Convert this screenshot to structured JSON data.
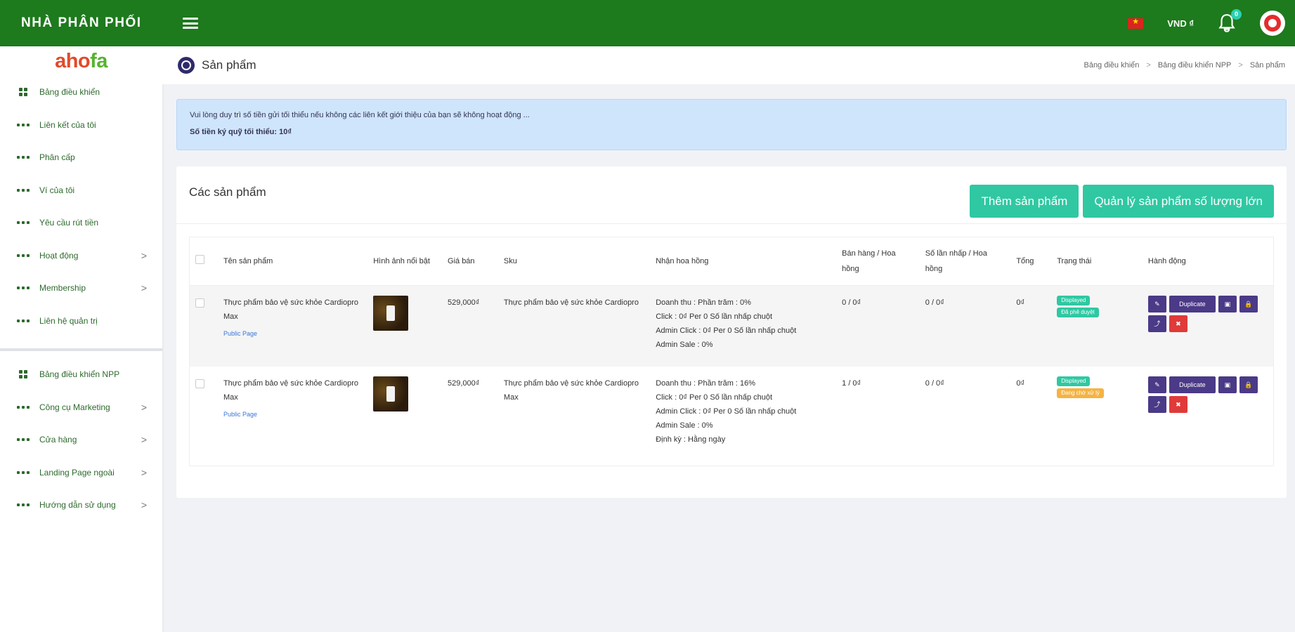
{
  "topbar": {
    "brand": "NHÀ PHÂN PHỐI",
    "currency": "VND ₫",
    "notification_count": "0"
  },
  "sidebar": {
    "logo": {
      "part1": "aho",
      "part2": "fa"
    },
    "items": [
      {
        "label": "Bảng điều khiển",
        "icon": "grid-icon",
        "chevron": ""
      },
      {
        "label": "Liên kết của tôi",
        "icon": "dots-icon",
        "chevron": ""
      },
      {
        "label": "Phân cấp",
        "icon": "dots-icon",
        "chevron": ""
      },
      {
        "label": "Ví của tôi",
        "icon": "dots-icon",
        "chevron": ""
      },
      {
        "label": "Yêu cầu rút tiền",
        "icon": "dots-icon",
        "chevron": ""
      },
      {
        "label": "Hoạt động",
        "icon": "dots-icon",
        "chevron": ">"
      },
      {
        "label": "Membership",
        "icon": "dots-icon",
        "chevron": ">"
      },
      {
        "label": "Liên hệ quản trị",
        "icon": "dots-icon",
        "chevron": ""
      }
    ],
    "items2": [
      {
        "label": "Bảng điều khiển NPP",
        "icon": "grid-icon",
        "chevron": ""
      },
      {
        "label": "Công cụ Marketing",
        "icon": "dots-icon",
        "chevron": ">"
      },
      {
        "label": "Cửa hàng",
        "icon": "dots-icon",
        "chevron": ">"
      },
      {
        "label": "Landing Page ngoài",
        "icon": "dots-icon",
        "chevron": ">"
      },
      {
        "label": "Hướng dẫn sử dụng",
        "icon": "dots-icon",
        "chevron": ">"
      }
    ]
  },
  "page": {
    "title": "Sản phẩm",
    "breadcrumb": [
      "Bảng điều khiển",
      "Bảng điều khiển NPP",
      "Sản phẩm"
    ]
  },
  "notice": {
    "line1": "Vui lòng duy trì số tiền gửi tối thiểu nếu không các liên kết giới thiệu của bạn sẽ không hoạt động ...",
    "line2": "Số tiền ký quỹ tối thiểu: 10₫"
  },
  "products": {
    "title": "Các sản phẩm",
    "add_button": "Thêm sản phẩm",
    "bulk_button": "Quản lý sản phẩm số lượng lớn",
    "columns": [
      "Tên sản phẩm",
      "Hình ảnh nổi bật",
      "Giá bán",
      "Sku",
      "Nhận hoa hồng",
      "Bán hàng / Hoa hồng",
      "Số lần nhấp / Hoa hồng",
      "Tổng",
      "Trạng thái",
      "Hành động"
    ],
    "rows": [
      {
        "name": "Thực phẩm bảo vệ sức khỏe Cardiopro Max",
        "link": "Public Page",
        "price": "529,000₫",
        "sku": "Thực phẩm bảo vệ sức khỏe Cardiopro",
        "commission": [
          "Doanh thu : Phần trăm : 0%",
          "Click : 0₫ Per 0 Số lần nhấp chuột",
          "Admin Click : 0₫ Per 0 Số lần nhấp chuột",
          "Admin Sale : 0%"
        ],
        "sales": "0 / 0₫",
        "clicks": "0 / 0₫",
        "total": "0₫",
        "status": [
          "Displayed",
          "Đã phê duyệt"
        ],
        "status_colors": [
          "#2fc8a2",
          "#2fc8a2"
        ]
      },
      {
        "name": "Thực phẩm bảo vệ sức khỏe Cardiopro Max",
        "link": "Public Page",
        "price": "529,000₫",
        "sku": "Thực phẩm bảo vệ sức khỏe Cardiopro Max",
        "commission": [
          "Doanh thu : Phần trăm : 16%",
          "Click : 0₫ Per 0 Số lần nhấp chuột",
          "Admin Click : 0₫ Per 0 Số lần nhấp chuột",
          "Admin Sale : 0%",
          "Định kỳ : Hằng ngày"
        ],
        "sales": "1 / 0₫",
        "clicks": "0 / 0₫",
        "total": "0₫",
        "status": [
          "Displayed",
          "Đang chờ xử lý"
        ],
        "status_colors": [
          "#2fc8a2",
          "#f5b342"
        ]
      }
    ],
    "action_labels": {
      "edit": "✎",
      "duplicate": "Duplicate",
      "image": "▣",
      "lock": "🔒",
      "share": "⤴",
      "delete": "✖"
    }
  }
}
